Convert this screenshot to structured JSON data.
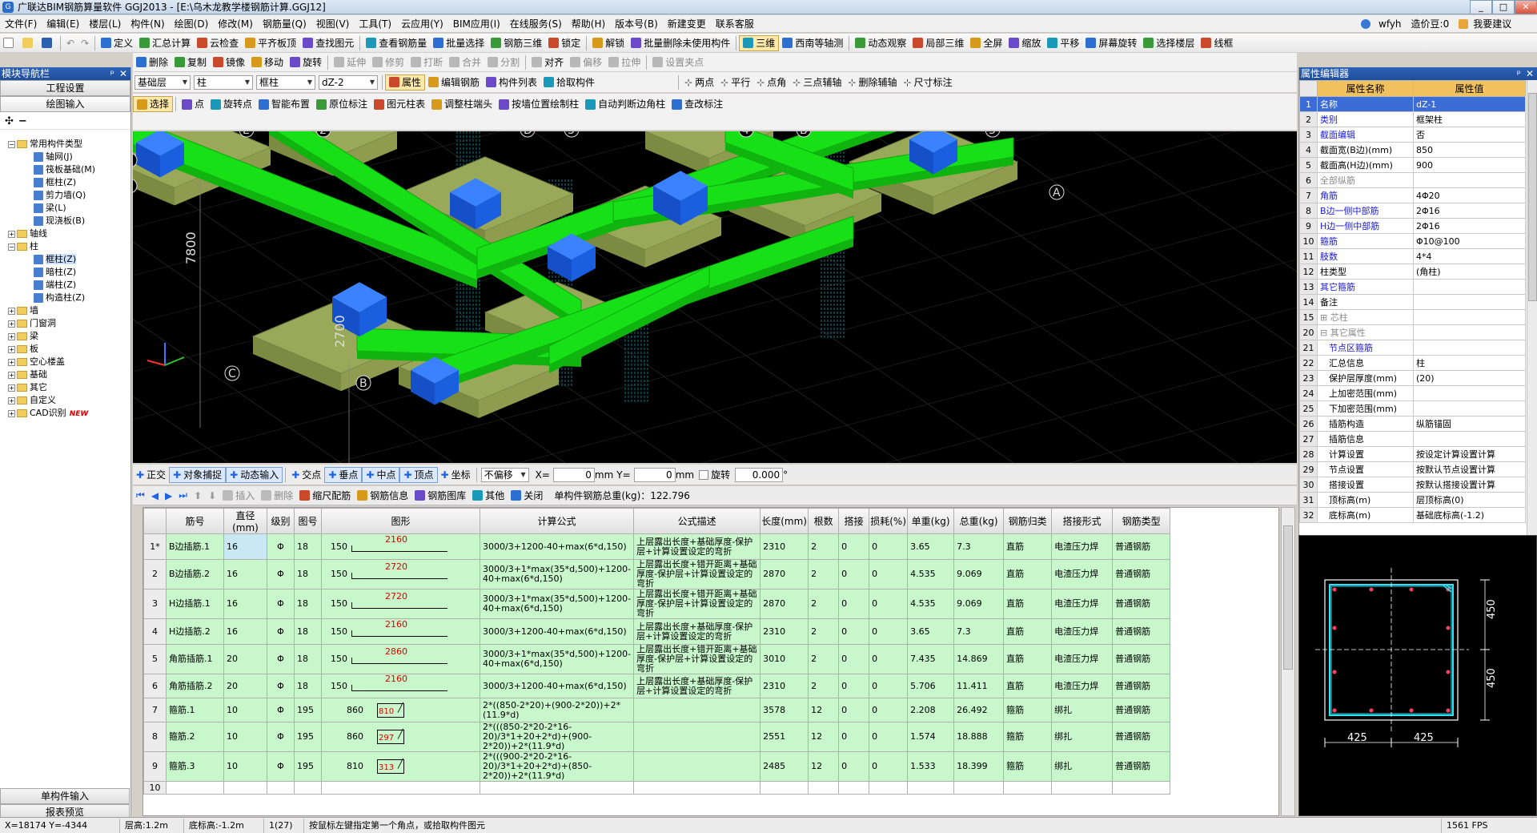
{
  "window": {
    "title": "广联达BIM钢筋算量软件 GGJ2013 - [E:\\乌木龙教学楼钢筋计算.GGJ12]",
    "min": "_",
    "max": "□",
    "close": "✕"
  },
  "menu": [
    "文件(F)",
    "编辑(E)",
    "楼层(L)",
    "构件(N)",
    "绘图(D)",
    "修改(M)",
    "钢筋量(Q)",
    "视图(V)",
    "工具(T)",
    "云应用(Y)",
    "BIM应用(I)",
    "在线服务(S)",
    "帮助(H)",
    "版本号(B)",
    "新建变更",
    "联系客服"
  ],
  "user": {
    "name": "wfyh",
    "coins": "造价豆:0",
    "ask": "我要建议"
  },
  "toolbar1": [
    "定义",
    "汇总计算",
    "云检查",
    "平齐板顶",
    "查找图元",
    "查看钢筋量",
    "批量选择",
    "钢筋三维",
    "锁定",
    "解锁",
    "批量删除未使用构件",
    "三维",
    "西南等轴测",
    "动态观察",
    "局部三维",
    "全屏",
    "缩放",
    "平移",
    "屏幕旋转",
    "选择楼层",
    "线框"
  ],
  "toolbar2": [
    "删除",
    "复制",
    "镜像",
    "移动",
    "旋转",
    "延伸",
    "修剪",
    "打断",
    "合并",
    "分割",
    "对齐",
    "偏移",
    "拉伸",
    "设置夹点"
  ],
  "toolbar3": {
    "floor": "基础层",
    "category": "柱",
    "subtype": "框柱",
    "component": "dZ-2",
    "buttons": [
      "属性",
      "编辑钢筋",
      "构件列表",
      "拾取构件"
    ],
    "draw": [
      "两点",
      "平行",
      "点角",
      "三点辅轴",
      "删除辅轴",
      "尺寸标注"
    ]
  },
  "toolbar4": [
    "选择",
    "点",
    "旋转点",
    "智能布置",
    "原位标注",
    "图元柱表",
    "调整柱端头",
    "按墙位置绘制柱",
    "自动判断边角柱",
    "查改标注"
  ],
  "leftnav": {
    "title": "模块导航栏",
    "pin": "ᵖ",
    "close": "✕",
    "btn_settings": "工程设置",
    "btn_input": "绘图输入",
    "btn_single": "单构件输入",
    "btn_report": "报表预览",
    "tree": [
      {
        "label": "常用构件类型",
        "level": 0,
        "exp": "−",
        "icon": "fold"
      },
      {
        "label": "轴网(J)",
        "level": 1,
        "icon": "cic"
      },
      {
        "label": "筏板基础(M)",
        "level": 1,
        "icon": "cic"
      },
      {
        "label": "框柱(Z)",
        "level": 1,
        "icon": "cic"
      },
      {
        "label": "剪力墙(Q)",
        "level": 1,
        "icon": "cic"
      },
      {
        "label": "梁(L)",
        "level": 1,
        "icon": "cic"
      },
      {
        "label": "现浇板(B)",
        "level": 1,
        "icon": "cic"
      },
      {
        "label": "轴线",
        "level": 0,
        "exp": "+",
        "icon": "fold"
      },
      {
        "label": "柱",
        "level": 0,
        "exp": "−",
        "icon": "fold"
      },
      {
        "label": "框柱(Z)",
        "level": 1,
        "icon": "cic",
        "sel": true
      },
      {
        "label": "暗柱(Z)",
        "level": 1,
        "icon": "cic"
      },
      {
        "label": "端柱(Z)",
        "level": 1,
        "icon": "cic"
      },
      {
        "label": "构造柱(Z)",
        "level": 1,
        "icon": "cic"
      },
      {
        "label": "墙",
        "level": 0,
        "exp": "+",
        "icon": "fold"
      },
      {
        "label": "门窗洞",
        "level": 0,
        "exp": "+",
        "icon": "fold"
      },
      {
        "label": "梁",
        "level": 0,
        "exp": "+",
        "icon": "fold"
      },
      {
        "label": "板",
        "level": 0,
        "exp": "+",
        "icon": "fold"
      },
      {
        "label": "空心楼盖",
        "level": 0,
        "exp": "+",
        "icon": "fold"
      },
      {
        "label": "基础",
        "level": 0,
        "exp": "+",
        "icon": "fold"
      },
      {
        "label": "其它",
        "level": 0,
        "exp": "+",
        "icon": "fold"
      },
      {
        "label": "自定义",
        "level": 0,
        "exp": "+",
        "icon": "fold"
      },
      {
        "label": "CAD识别",
        "level": 0,
        "exp": "+",
        "icon": "fold",
        "badge": "NEW"
      }
    ]
  },
  "viewport": {
    "axes": [
      "E",
      "2",
      "D",
      "3",
      "4",
      "B",
      "5",
      "1",
      "E",
      "A",
      "C",
      "B"
    ],
    "dims": [
      "7800",
      "2700"
    ]
  },
  "snapbar": {
    "items": [
      "正交",
      "对象捕捉",
      "动态输入",
      "交点",
      "垂点",
      "中点",
      "顶点",
      "坐标"
    ],
    "offset": "不偏移",
    "x_label": "X=",
    "x_val": "0",
    "mm1": "mm",
    "y_label": "Y=",
    "y_val": "0",
    "mm2": "mm",
    "rot_label": "旋转",
    "rot_val": "0.000",
    "deg": "°"
  },
  "gridbar": {
    "items": [
      "插入",
      "删除",
      "缩尺配筋",
      "钢筋信息",
      "钢筋图库",
      "其他",
      "关闭"
    ],
    "total": "单构件钢筋总重(kg)：122.796"
  },
  "rebar": {
    "headers": [
      "",
      "筋号",
      "直径(mm)",
      "级别",
      "图号",
      "图形",
      "计算公式",
      "公式描述",
      "长度(mm)",
      "根数",
      "搭接",
      "损耗(%)",
      "单重(kg)",
      "总重(kg)",
      "钢筋归类",
      "搭接形式",
      "钢筋类型"
    ],
    "rows": [
      {
        "no": "1*",
        "name": "B边插筋.1",
        "dia": "16",
        "grade": "Φ",
        "fig": "18",
        "s1": "150",
        "s2": "2160",
        "formula": "3000/3+1200-40+max(6*d,150)",
        "desc": "上层露出长度+基础厚度-保护层+计算设置设定的弯折",
        "len": "2310",
        "count": "2",
        "lap": "0",
        "loss": "0",
        "unit": "3.65",
        "total": "7.3",
        "cls": "直筋",
        "lapform": "电渣压力焊",
        "type": "普通钢筋"
      },
      {
        "no": "2",
        "name": "B边插筋.2",
        "dia": "16",
        "grade": "Φ",
        "fig": "18",
        "s1": "150",
        "s2": "2720",
        "formula": "3000/3+1*max(35*d,500)+1200-40+max(6*d,150)",
        "desc": "上层露出长度+错开距离+基础厚度-保护层+计算设置设定的弯折",
        "len": "2870",
        "count": "2",
        "lap": "0",
        "loss": "0",
        "unit": "4.535",
        "total": "9.069",
        "cls": "直筋",
        "lapform": "电渣压力焊",
        "type": "普通钢筋"
      },
      {
        "no": "3",
        "name": "H边插筋.1",
        "dia": "16",
        "grade": "Φ",
        "fig": "18",
        "s1": "150",
        "s2": "2720",
        "formula": "3000/3+1*max(35*d,500)+1200-40+max(6*d,150)",
        "desc": "上层露出长度+错开距离+基础厚度-保护层+计算设置设定的弯折",
        "len": "2870",
        "count": "2",
        "lap": "0",
        "loss": "0",
        "unit": "4.535",
        "total": "9.069",
        "cls": "直筋",
        "lapform": "电渣压力焊",
        "type": "普通钢筋"
      },
      {
        "no": "4",
        "name": "H边插筋.2",
        "dia": "16",
        "grade": "Φ",
        "fig": "18",
        "s1": "150",
        "s2": "2160",
        "formula": "3000/3+1200-40+max(6*d,150)",
        "desc": "上层露出长度+基础厚度-保护层+计算设置设定的弯折",
        "len": "2310",
        "count": "2",
        "lap": "0",
        "loss": "0",
        "unit": "3.65",
        "total": "7.3",
        "cls": "直筋",
        "lapform": "电渣压力焊",
        "type": "普通钢筋"
      },
      {
        "no": "5",
        "name": "角筋插筋.1",
        "dia": "20",
        "grade": "Φ",
        "fig": "18",
        "s1": "150",
        "s2": "2860",
        "formula": "3000/3+1*max(35*d,500)+1200-40+max(6*d,150)",
        "desc": "上层露出长度+错开距离+基础厚度-保护层+计算设置设定的弯折",
        "len": "3010",
        "count": "2",
        "lap": "0",
        "loss": "0",
        "unit": "7.435",
        "total": "14.869",
        "cls": "直筋",
        "lapform": "电渣压力焊",
        "type": "普通钢筋"
      },
      {
        "no": "6",
        "name": "角筋插筋.2",
        "dia": "20",
        "grade": "Φ",
        "fig": "18",
        "s1": "150",
        "s2": "2160",
        "formula": "3000/3+1200-40+max(6*d,150)",
        "desc": "上层露出长度+基础厚度-保护层+计算设置设定的弯折",
        "len": "2310",
        "count": "2",
        "lap": "0",
        "loss": "0",
        "unit": "5.706",
        "total": "11.411",
        "cls": "直筋",
        "lapform": "电渣压力焊",
        "type": "普通钢筋"
      },
      {
        "no": "7",
        "name": "箍筋.1",
        "dia": "10",
        "grade": "Φ",
        "fig": "195",
        "s1": "860",
        "s2": "810",
        "formula": "2*((850-2*20)+(900-2*20))+2*(11.9*d)",
        "desc": "",
        "len": "3578",
        "count": "12",
        "lap": "0",
        "loss": "0",
        "unit": "2.208",
        "total": "26.492",
        "cls": "箍筋",
        "lapform": "绑扎",
        "type": "普通钢筋"
      },
      {
        "no": "8",
        "name": "箍筋.2",
        "dia": "10",
        "grade": "Φ",
        "fig": "195",
        "s1": "860",
        "s2": "297",
        "formula": "2*(((850-2*20-2*16-20)/3*1+20+2*d)+(900-2*20))+2*(11.9*d)",
        "desc": "",
        "len": "2551",
        "count": "12",
        "lap": "0",
        "loss": "0",
        "unit": "1.574",
        "total": "18.888",
        "cls": "箍筋",
        "lapform": "绑扎",
        "type": "普通钢筋"
      },
      {
        "no": "9",
        "name": "箍筋.3",
        "dia": "10",
        "grade": "Φ",
        "fig": "195",
        "s1": "810",
        "s2": "313",
        "formula": "2*(((900-2*20-2*16-20)/3*1+20+2*d)+(850-2*20))+2*(11.9*d)",
        "desc": "",
        "len": "2485",
        "count": "12",
        "lap": "0",
        "loss": "0",
        "unit": "1.533",
        "total": "18.399",
        "cls": "箍筋",
        "lapform": "绑扎",
        "type": "普通钢筋"
      },
      {
        "no": "10",
        "name": "",
        "dia": "",
        "grade": "",
        "fig": "",
        "s1": "",
        "s2": "",
        "formula": "",
        "desc": "",
        "len": "",
        "count": "",
        "lap": "",
        "loss": "",
        "unit": "",
        "total": "",
        "cls": "",
        "lapform": "",
        "type": ""
      }
    ]
  },
  "props": {
    "title": "属性编辑器",
    "h_name": "属性名称",
    "h_val": "属性值",
    "rows": [
      {
        "no": "1",
        "name": "名称",
        "val": "dZ-1",
        "style": "blue",
        "hl": true
      },
      {
        "no": "2",
        "name": "类别",
        "val": "框架柱",
        "style": "blue"
      },
      {
        "no": "3",
        "name": "截面编辑",
        "val": "否",
        "style": "blue"
      },
      {
        "no": "4",
        "name": "截面宽(B边)(mm)",
        "val": "850",
        "style": ""
      },
      {
        "no": "5",
        "name": "截面高(H边)(mm)",
        "val": "900",
        "style": ""
      },
      {
        "no": "6",
        "name": "全部纵筋",
        "val": "",
        "style": "gray"
      },
      {
        "no": "7",
        "name": "角筋",
        "val": "4Φ20",
        "style": "blue"
      },
      {
        "no": "8",
        "name": "B边一侧中部筋",
        "val": "2Φ16",
        "style": "blue"
      },
      {
        "no": "9",
        "name": "H边一侧中部筋",
        "val": "2Φ16",
        "style": "blue"
      },
      {
        "no": "10",
        "name": "箍筋",
        "val": "Φ10@100",
        "style": "blue"
      },
      {
        "no": "11",
        "name": "肢数",
        "val": "4*4",
        "style": "blue"
      },
      {
        "no": "12",
        "name": "柱类型",
        "val": "(角柱)",
        "style": ""
      },
      {
        "no": "13",
        "name": "其它箍筋",
        "val": "",
        "style": "blue"
      },
      {
        "no": "14",
        "name": "备注",
        "val": "",
        "style": ""
      },
      {
        "no": "15",
        "name": "⊞ 芯柱",
        "val": "",
        "style": "gray"
      },
      {
        "no": "20",
        "name": "⊟ 其它属性",
        "val": "",
        "style": "gray"
      },
      {
        "no": "21",
        "name": "　节点区箍筋",
        "val": "",
        "style": "blue"
      },
      {
        "no": "22",
        "name": "　汇总信息",
        "val": "柱",
        "style": ""
      },
      {
        "no": "23",
        "name": "　保护层厚度(mm)",
        "val": "(20)",
        "style": ""
      },
      {
        "no": "24",
        "name": "　上加密范围(mm)",
        "val": "",
        "style": ""
      },
      {
        "no": "25",
        "name": "　下加密范围(mm)",
        "val": "",
        "style": ""
      },
      {
        "no": "26",
        "name": "　插筋构造",
        "val": "纵筋锚固",
        "style": ""
      },
      {
        "no": "27",
        "name": "　插筋信息",
        "val": "",
        "style": ""
      },
      {
        "no": "28",
        "name": "　计算设置",
        "val": "按设定计算设置计算",
        "style": ""
      },
      {
        "no": "29",
        "name": "　节点设置",
        "val": "按默认节点设置计算",
        "style": ""
      },
      {
        "no": "30",
        "name": "　搭接设置",
        "val": "按默认搭接设置计算",
        "style": ""
      },
      {
        "no": "31",
        "name": "　顶标高(m)",
        "val": "层顶标高(0)",
        "style": ""
      },
      {
        "no": "32",
        "name": "　底标高(m)",
        "val": "基础底标高(-1.2)",
        "style": ""
      }
    ]
  },
  "preview": {
    "dim_v1": "450",
    "dim_v2": "450",
    "dim_h1": "425",
    "dim_h2": "425"
  },
  "status": {
    "coords": "X=18174 Y=-4344",
    "floor_h": "层高:1.2m",
    "bottom": "底标高:-1.2m",
    "count": "1(27)",
    "hint": "按鼠标左键指定第一个角点，或拾取构件图元",
    "fps": "1561 FPS"
  },
  "colors": {
    "beam": "#17e017",
    "footing": "#9aa85a",
    "column": "#1e62e8",
    "tablebg": "#c8f7cc",
    "header": "#f0c15f"
  }
}
